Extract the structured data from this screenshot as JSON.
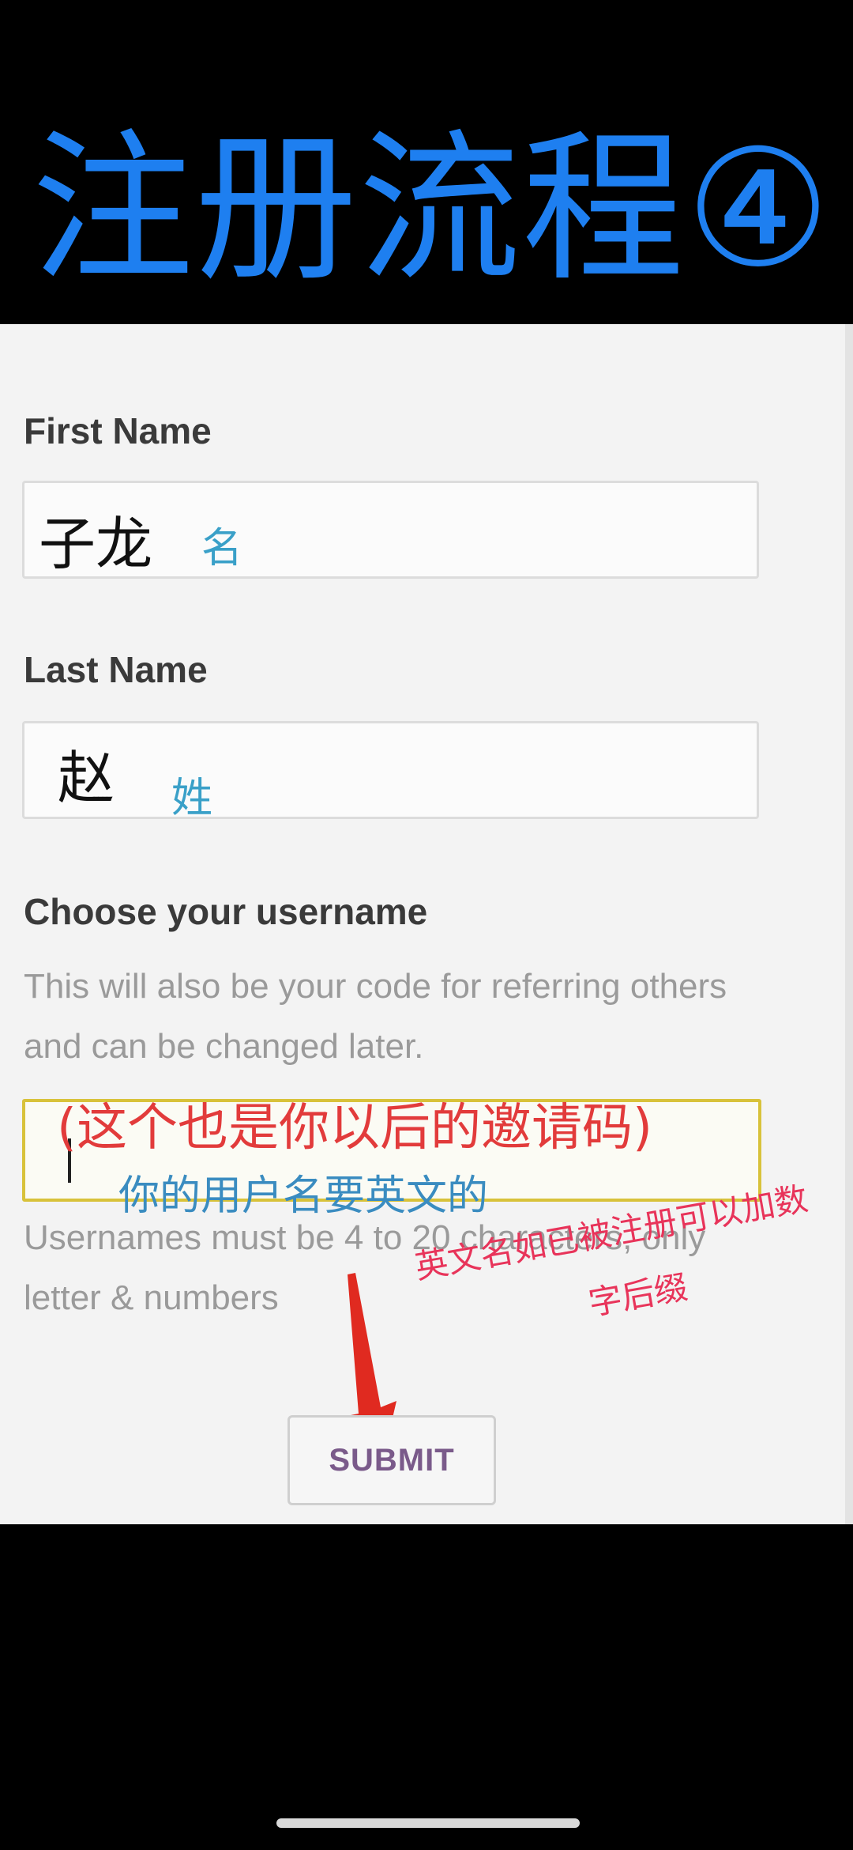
{
  "banner": {
    "title": "注册流程④"
  },
  "form": {
    "first_name": {
      "label": "First Name",
      "value": "子龙",
      "hint": "名"
    },
    "last_name": {
      "label": "Last Name",
      "value": "赵",
      "hint": "姓"
    },
    "username": {
      "label": "Choose your username",
      "help": "This will also be your code for referring others and can be changed later.",
      "value": "",
      "rule": "Usernames must be 4 to 20 characters, only letter & numbers",
      "annotation_invite": "(这个也是你以后的邀请码)",
      "annotation_english": "你的用户名要英文的",
      "annotation_suffix_line1": "英文名如已被注册可以加数",
      "annotation_suffix_line2": "字后缀"
    },
    "submit_label": "SUBMIT"
  },
  "colors": {
    "banner_title": "#1e7ff0",
    "annotation_red": "#e23b3b",
    "annotation_pink": "#e8345a",
    "hint_blue": "#3aa0c8"
  }
}
